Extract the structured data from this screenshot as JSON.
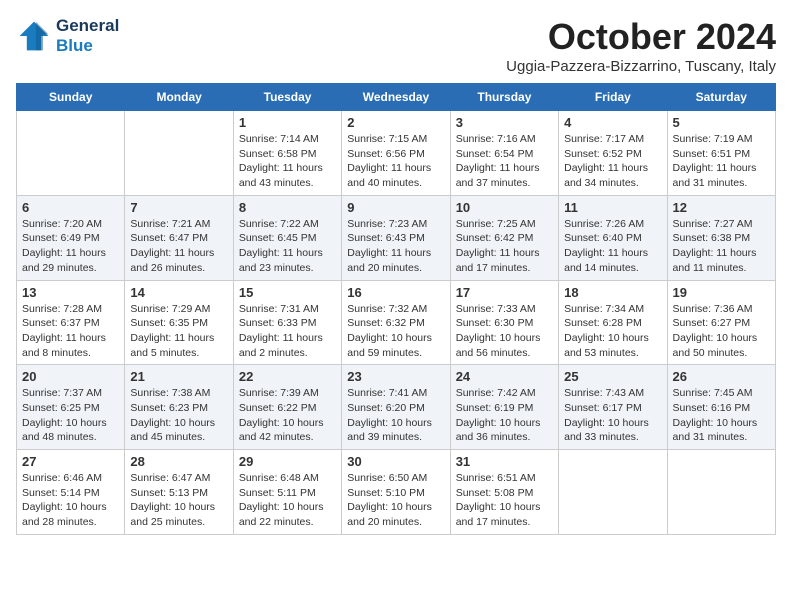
{
  "header": {
    "logo_line1": "General",
    "logo_line2": "Blue",
    "month": "October 2024",
    "location": "Uggia-Pazzera-Bizzarrino, Tuscany, Italy"
  },
  "days_of_week": [
    "Sunday",
    "Monday",
    "Tuesday",
    "Wednesday",
    "Thursday",
    "Friday",
    "Saturday"
  ],
  "weeks": [
    [
      {
        "day": "",
        "sunrise": "",
        "sunset": "",
        "daylight": ""
      },
      {
        "day": "",
        "sunrise": "",
        "sunset": "",
        "daylight": ""
      },
      {
        "day": "1",
        "sunrise": "Sunrise: 7:14 AM",
        "sunset": "Sunset: 6:58 PM",
        "daylight": "Daylight: 11 hours and 43 minutes."
      },
      {
        "day": "2",
        "sunrise": "Sunrise: 7:15 AM",
        "sunset": "Sunset: 6:56 PM",
        "daylight": "Daylight: 11 hours and 40 minutes."
      },
      {
        "day": "3",
        "sunrise": "Sunrise: 7:16 AM",
        "sunset": "Sunset: 6:54 PM",
        "daylight": "Daylight: 11 hours and 37 minutes."
      },
      {
        "day": "4",
        "sunrise": "Sunrise: 7:17 AM",
        "sunset": "Sunset: 6:52 PM",
        "daylight": "Daylight: 11 hours and 34 minutes."
      },
      {
        "day": "5",
        "sunrise": "Sunrise: 7:19 AM",
        "sunset": "Sunset: 6:51 PM",
        "daylight": "Daylight: 11 hours and 31 minutes."
      }
    ],
    [
      {
        "day": "6",
        "sunrise": "Sunrise: 7:20 AM",
        "sunset": "Sunset: 6:49 PM",
        "daylight": "Daylight: 11 hours and 29 minutes."
      },
      {
        "day": "7",
        "sunrise": "Sunrise: 7:21 AM",
        "sunset": "Sunset: 6:47 PM",
        "daylight": "Daylight: 11 hours and 26 minutes."
      },
      {
        "day": "8",
        "sunrise": "Sunrise: 7:22 AM",
        "sunset": "Sunset: 6:45 PM",
        "daylight": "Daylight: 11 hours and 23 minutes."
      },
      {
        "day": "9",
        "sunrise": "Sunrise: 7:23 AM",
        "sunset": "Sunset: 6:43 PM",
        "daylight": "Daylight: 11 hours and 20 minutes."
      },
      {
        "day": "10",
        "sunrise": "Sunrise: 7:25 AM",
        "sunset": "Sunset: 6:42 PM",
        "daylight": "Daylight: 11 hours and 17 minutes."
      },
      {
        "day": "11",
        "sunrise": "Sunrise: 7:26 AM",
        "sunset": "Sunset: 6:40 PM",
        "daylight": "Daylight: 11 hours and 14 minutes."
      },
      {
        "day": "12",
        "sunrise": "Sunrise: 7:27 AM",
        "sunset": "Sunset: 6:38 PM",
        "daylight": "Daylight: 11 hours and 11 minutes."
      }
    ],
    [
      {
        "day": "13",
        "sunrise": "Sunrise: 7:28 AM",
        "sunset": "Sunset: 6:37 PM",
        "daylight": "Daylight: 11 hours and 8 minutes."
      },
      {
        "day": "14",
        "sunrise": "Sunrise: 7:29 AM",
        "sunset": "Sunset: 6:35 PM",
        "daylight": "Daylight: 11 hours and 5 minutes."
      },
      {
        "day": "15",
        "sunrise": "Sunrise: 7:31 AM",
        "sunset": "Sunset: 6:33 PM",
        "daylight": "Daylight: 11 hours and 2 minutes."
      },
      {
        "day": "16",
        "sunrise": "Sunrise: 7:32 AM",
        "sunset": "Sunset: 6:32 PM",
        "daylight": "Daylight: 10 hours and 59 minutes."
      },
      {
        "day": "17",
        "sunrise": "Sunrise: 7:33 AM",
        "sunset": "Sunset: 6:30 PM",
        "daylight": "Daylight: 10 hours and 56 minutes."
      },
      {
        "day": "18",
        "sunrise": "Sunrise: 7:34 AM",
        "sunset": "Sunset: 6:28 PM",
        "daylight": "Daylight: 10 hours and 53 minutes."
      },
      {
        "day": "19",
        "sunrise": "Sunrise: 7:36 AM",
        "sunset": "Sunset: 6:27 PM",
        "daylight": "Daylight: 10 hours and 50 minutes."
      }
    ],
    [
      {
        "day": "20",
        "sunrise": "Sunrise: 7:37 AM",
        "sunset": "Sunset: 6:25 PM",
        "daylight": "Daylight: 10 hours and 48 minutes."
      },
      {
        "day": "21",
        "sunrise": "Sunrise: 7:38 AM",
        "sunset": "Sunset: 6:23 PM",
        "daylight": "Daylight: 10 hours and 45 minutes."
      },
      {
        "day": "22",
        "sunrise": "Sunrise: 7:39 AM",
        "sunset": "Sunset: 6:22 PM",
        "daylight": "Daylight: 10 hours and 42 minutes."
      },
      {
        "day": "23",
        "sunrise": "Sunrise: 7:41 AM",
        "sunset": "Sunset: 6:20 PM",
        "daylight": "Daylight: 10 hours and 39 minutes."
      },
      {
        "day": "24",
        "sunrise": "Sunrise: 7:42 AM",
        "sunset": "Sunset: 6:19 PM",
        "daylight": "Daylight: 10 hours and 36 minutes."
      },
      {
        "day": "25",
        "sunrise": "Sunrise: 7:43 AM",
        "sunset": "Sunset: 6:17 PM",
        "daylight": "Daylight: 10 hours and 33 minutes."
      },
      {
        "day": "26",
        "sunrise": "Sunrise: 7:45 AM",
        "sunset": "Sunset: 6:16 PM",
        "daylight": "Daylight: 10 hours and 31 minutes."
      }
    ],
    [
      {
        "day": "27",
        "sunrise": "Sunrise: 6:46 AM",
        "sunset": "Sunset: 5:14 PM",
        "daylight": "Daylight: 10 hours and 28 minutes."
      },
      {
        "day": "28",
        "sunrise": "Sunrise: 6:47 AM",
        "sunset": "Sunset: 5:13 PM",
        "daylight": "Daylight: 10 hours and 25 minutes."
      },
      {
        "day": "29",
        "sunrise": "Sunrise: 6:48 AM",
        "sunset": "Sunset: 5:11 PM",
        "daylight": "Daylight: 10 hours and 22 minutes."
      },
      {
        "day": "30",
        "sunrise": "Sunrise: 6:50 AM",
        "sunset": "Sunset: 5:10 PM",
        "daylight": "Daylight: 10 hours and 20 minutes."
      },
      {
        "day": "31",
        "sunrise": "Sunrise: 6:51 AM",
        "sunset": "Sunset: 5:08 PM",
        "daylight": "Daylight: 10 hours and 17 minutes."
      },
      {
        "day": "",
        "sunrise": "",
        "sunset": "",
        "daylight": ""
      },
      {
        "day": "",
        "sunrise": "",
        "sunset": "",
        "daylight": ""
      }
    ]
  ]
}
